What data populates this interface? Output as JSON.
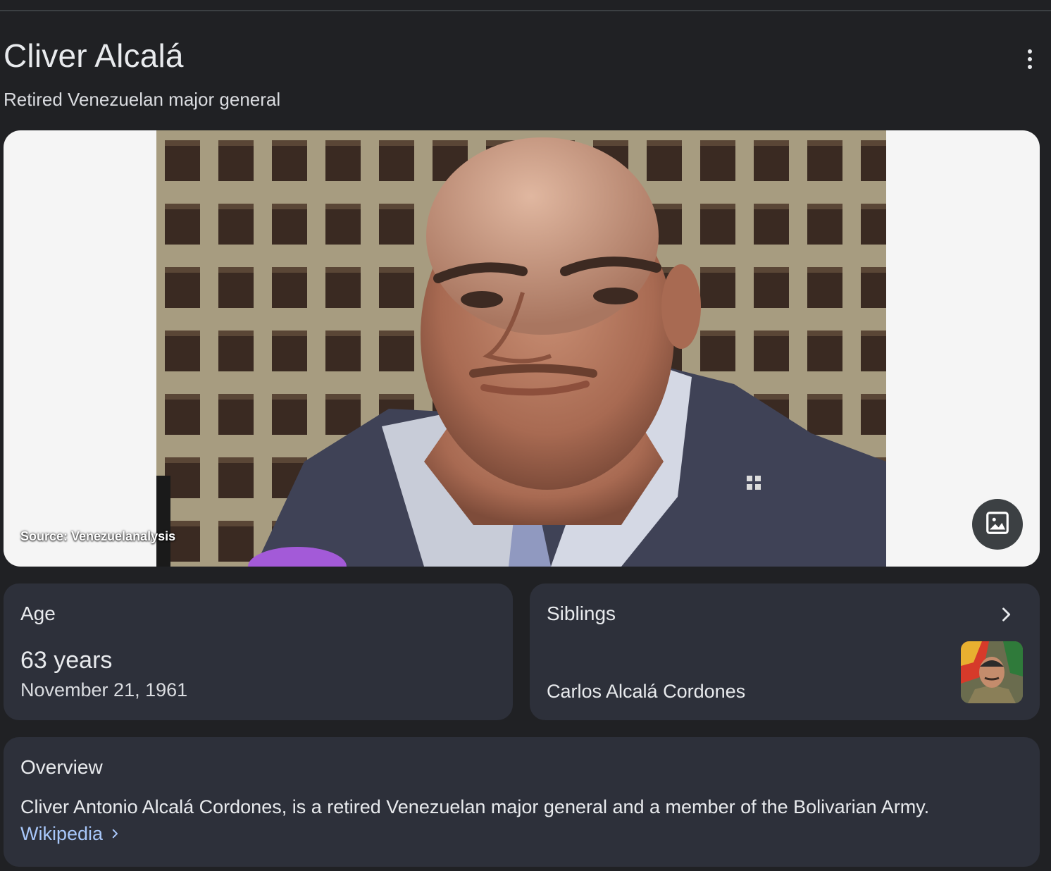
{
  "entity": {
    "title": "Cliver Alcalá",
    "subtitle": "Retired Venezuelan major general"
  },
  "hero": {
    "source_caption": "Source: Venezuelanalysis"
  },
  "age_card": {
    "label": "Age",
    "value": "63 years",
    "date": "November 21, 1961"
  },
  "siblings_card": {
    "label": "Siblings",
    "name": "Carlos Alcalá Cordones"
  },
  "overview_card": {
    "label": "Overview",
    "text": "Cliver Antonio Alcalá Cordones, is a retired Venezuelan major general and a member of the Bolivarian Army.",
    "link_label": "Wikipedia"
  },
  "icons": {
    "more": "more-vert-icon",
    "image": "image-icon",
    "chevron": "chevron-right-icon"
  },
  "colors": {
    "background": "#202124",
    "card": "#2d303a",
    "link": "#a8c7fa",
    "hero_bg": "#f5f5f5"
  }
}
